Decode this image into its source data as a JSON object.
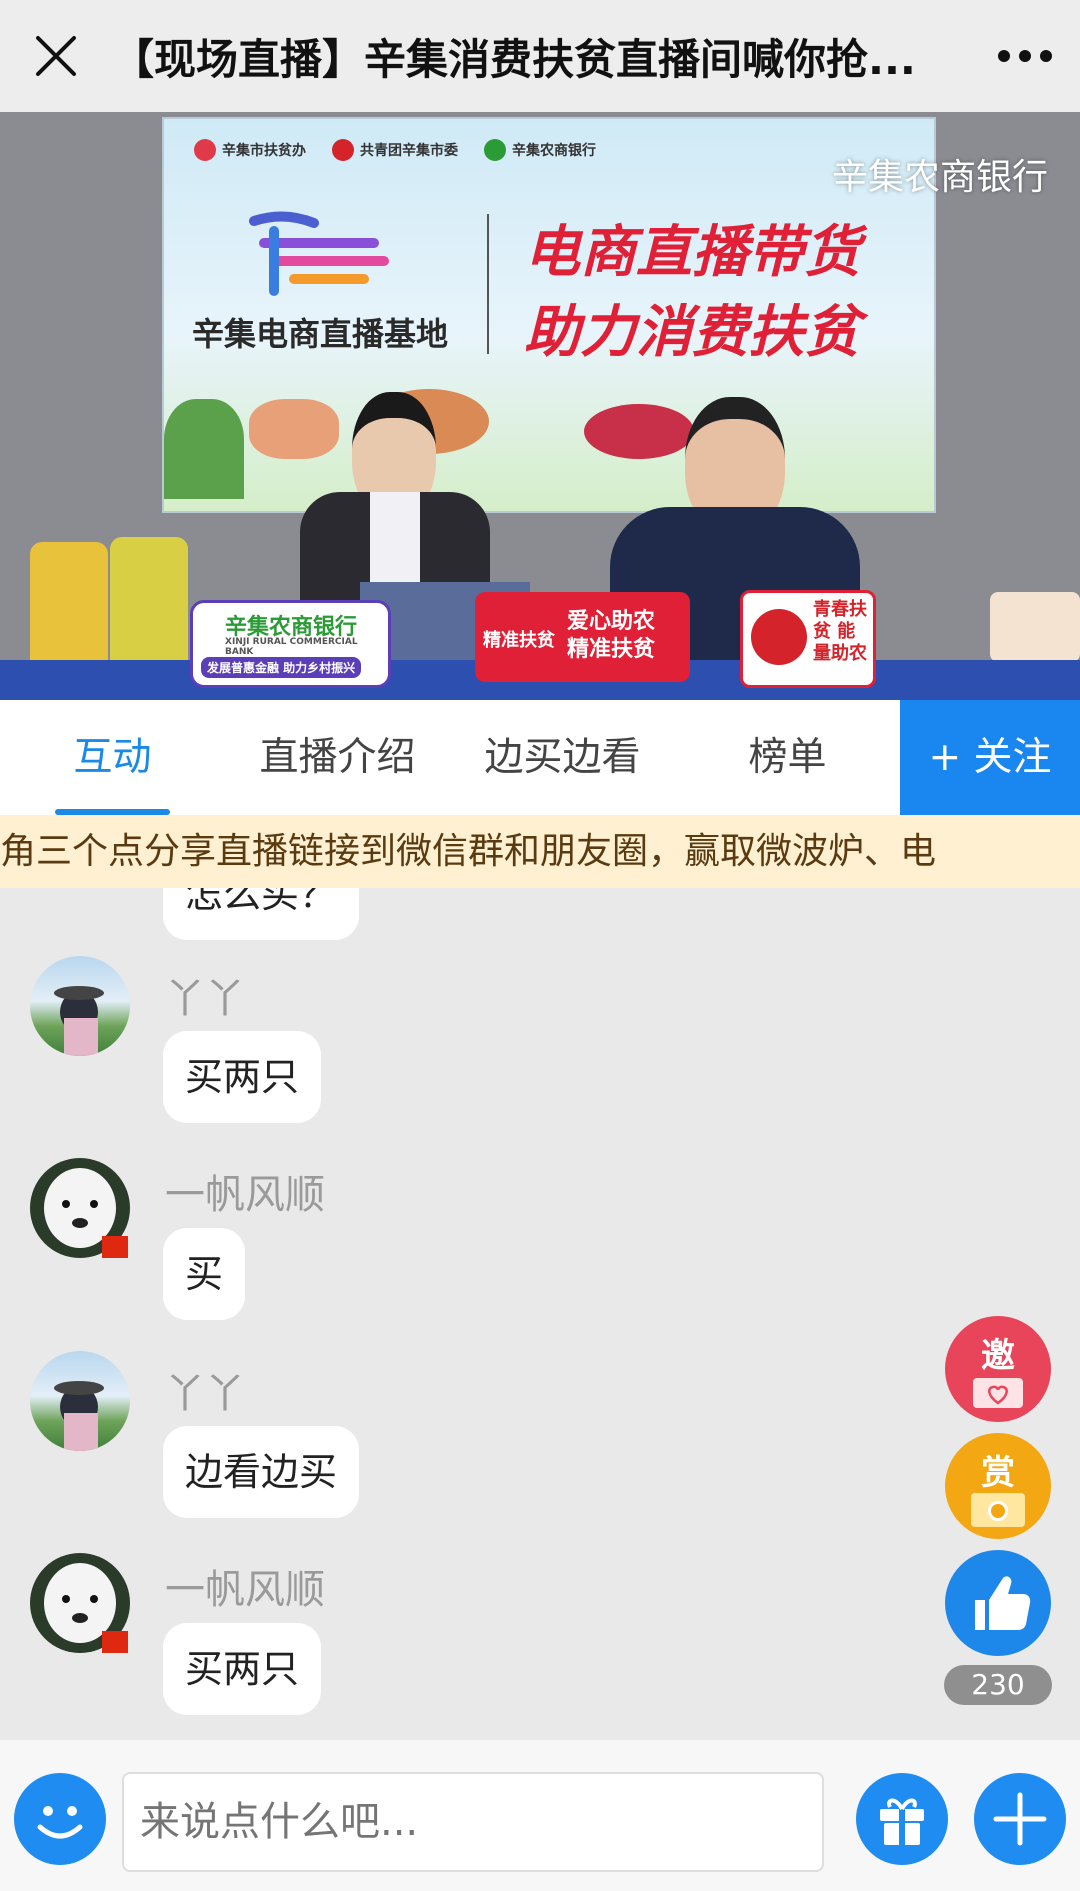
{
  "titlebar": {
    "title": "【现场直播】辛集消费扶贫直播间喊你抢...",
    "close_icon": "close-icon",
    "more_icon": "more-icon"
  },
  "video": {
    "watermark": "辛集农商银行",
    "sponsors": [
      "辛集市扶贫办",
      "共青团辛集市委",
      "辛集农商银行"
    ],
    "base_name": "辛集电商直播基地",
    "slogan_line1": "电商直播带货",
    "slogan_line2": "助力消费扶贫",
    "desk_badge_title": "辛集农商银行",
    "desk_badge_sub": "XINJI RURAL COMMERCIAL BANK",
    "desk_badge_line": "发展普惠金融 助力乡村振兴",
    "sign_left_tag": "精准扶贫",
    "sign_left_main": "爱心助农 精准扶贫",
    "sign_right": "青春扶贫 能量助农"
  },
  "tabs": [
    {
      "label": "互动",
      "active": true
    },
    {
      "label": "直播介绍",
      "active": false
    },
    {
      "label": "边买边看",
      "active": false
    },
    {
      "label": "榜单",
      "active": false
    }
  ],
  "follow_label": "+ 关注",
  "marquee_text": "角三个点分享直播链接到微信群和朋友圈，赢取微波炉、电",
  "chat": {
    "partial_bubble": "怎么买？",
    "messages": [
      {
        "user": "丫丫",
        "text": "买两只",
        "avatar": "landscape-avatar"
      },
      {
        "user": "一帆风顺",
        "text": "买",
        "avatar": "poodle-avatar"
      },
      {
        "user": "丫丫",
        "text": "边看边买",
        "avatar": "landscape-avatar"
      },
      {
        "user": "一帆风顺",
        "text": "买两只",
        "avatar": "poodle-avatar"
      }
    ]
  },
  "floating": {
    "invite_label": "邀",
    "reward_label": "赏",
    "like_count": "230"
  },
  "input": {
    "placeholder": "来说点什么吧..."
  },
  "colors": {
    "accent": "#1a86f0",
    "marquee_bg": "#fff0d2",
    "invite": "#e8445a",
    "reward": "#f3a712"
  }
}
